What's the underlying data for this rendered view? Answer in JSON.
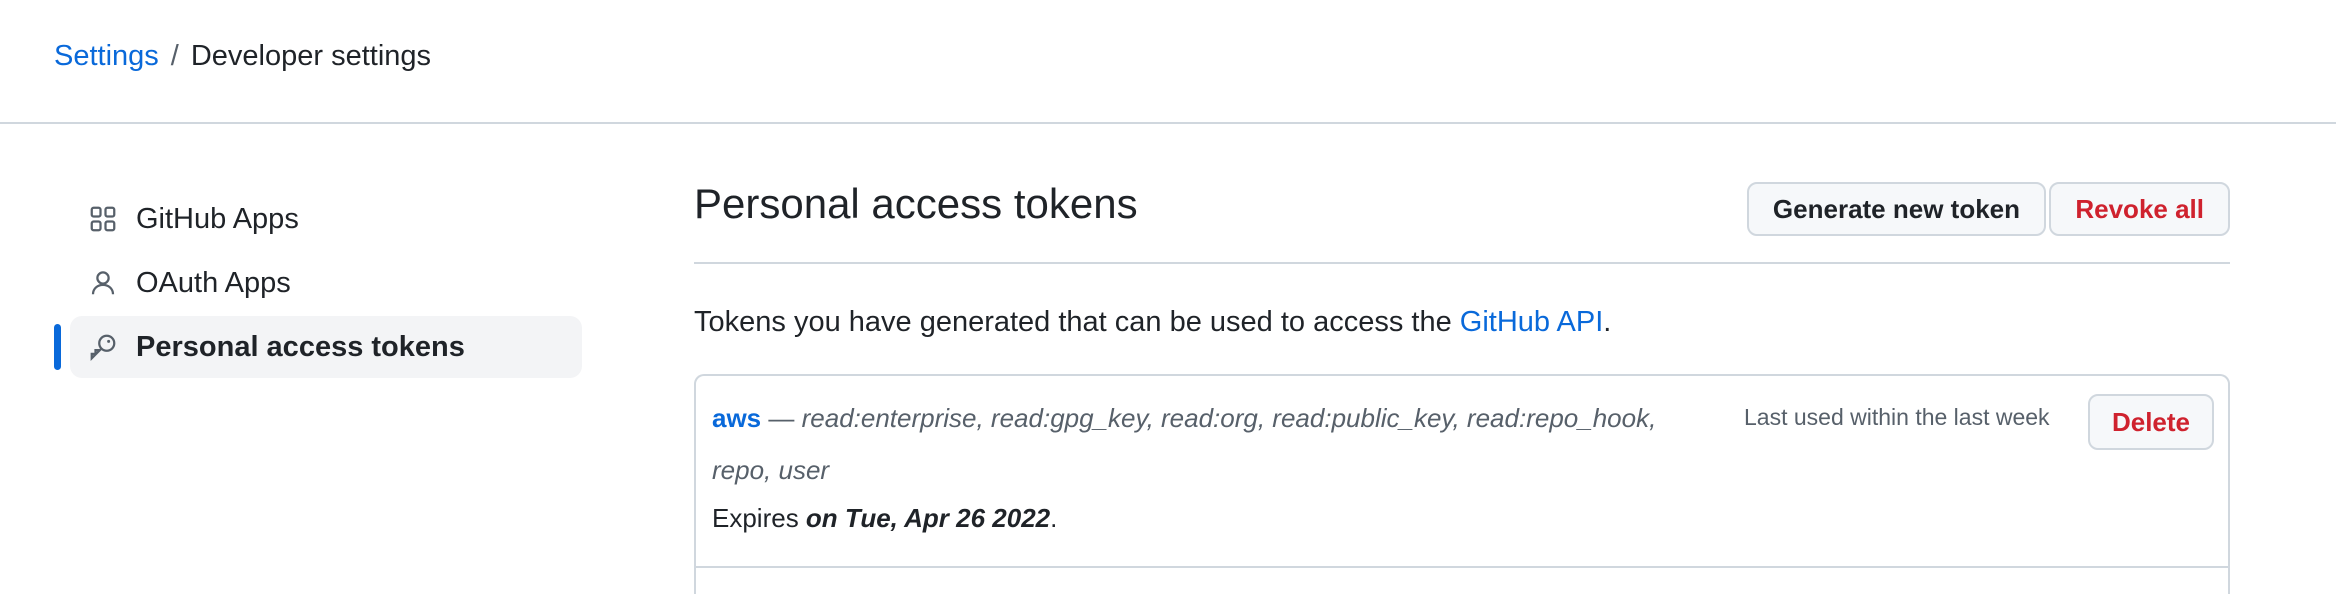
{
  "breadcrumb": {
    "root": "Settings",
    "separator": "/",
    "current": "Developer settings"
  },
  "sidebar": {
    "items": [
      {
        "label": "GitHub Apps",
        "icon": "apps-grid-icon",
        "active": false
      },
      {
        "label": "OAuth Apps",
        "icon": "person-icon",
        "active": false
      },
      {
        "label": "Personal access tokens",
        "icon": "key-icon",
        "active": true
      }
    ]
  },
  "main": {
    "title": "Personal access tokens",
    "generate_label": "Generate new token",
    "revoke_label": "Revoke all",
    "intro_prefix": "Tokens you have generated that can be used to access the ",
    "intro_link": "GitHub API",
    "intro_suffix": "."
  },
  "tokens": [
    {
      "name": "aws",
      "dash": " — ",
      "scopes": "read:enterprise, read:gpg_key, read:org, read:public_key, read:repo_hook, repo, user",
      "last_used": "Last used within the last week",
      "delete_label": "Delete",
      "expires_prefix": "Expires ",
      "expires_value": "on Tue, Apr 26 2022",
      "expires_suffix": "."
    }
  ],
  "colors": {
    "link": "#0969da",
    "danger": "#cf222e",
    "active_bar": "#0969da"
  }
}
